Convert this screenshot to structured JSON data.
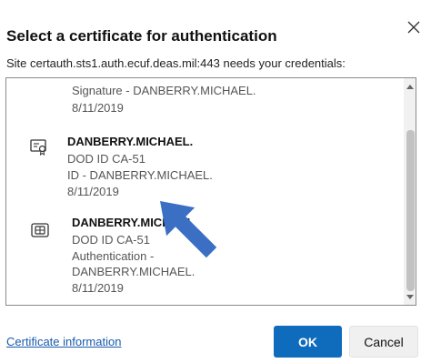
{
  "dialog": {
    "title": "Select a certificate for authentication",
    "subtitle": "Site certauth.sts1.auth.ecuf.deas.mil:443 needs your credentials:",
    "close_icon": "close-icon"
  },
  "certificates": [
    {
      "lines": [
        "Signature - DANBERRY.MICHAEL.",
        "8/11/2019"
      ],
      "icon": null
    },
    {
      "name": "DANBERRY.MICHAEL.",
      "lines": [
        "DOD ID CA-51",
        "ID - DANBERRY.MICHAEL.",
        "8/11/2019"
      ],
      "icon": "certificate-icon"
    },
    {
      "name": "DANBERRY.MICHAEL",
      "lines": [
        "DOD ID CA-51",
        "Authentication -",
        "DANBERRY.MICHAEL.",
        "8/11/2019"
      ],
      "icon": "smart-card-icon"
    }
  ],
  "footer": {
    "link": "Certificate information",
    "ok_label": "OK",
    "cancel_label": "Cancel"
  },
  "colors": {
    "accent": "#0f6cbd",
    "link": "#1a5aab",
    "arrow": "#3a6fc4"
  }
}
